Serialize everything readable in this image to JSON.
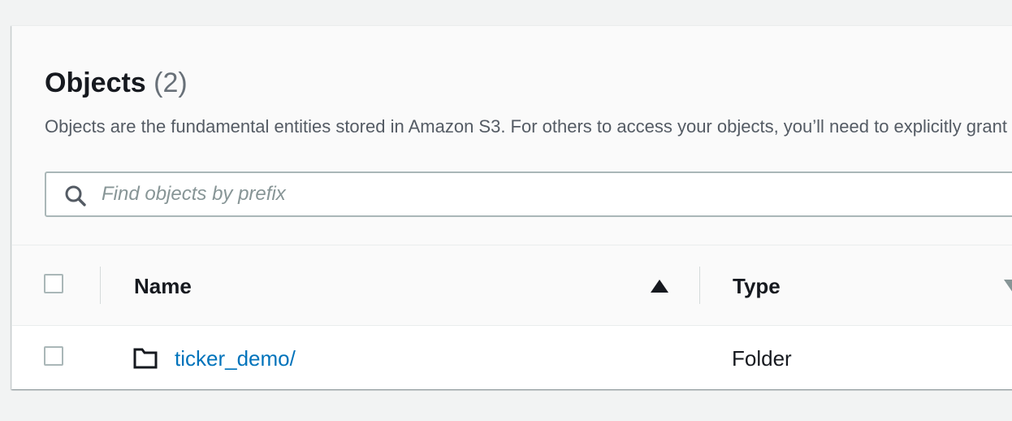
{
  "objects_panel": {
    "title": "Objects",
    "count": "(2)",
    "description": "Objects are the fundamental entities stored in Amazon S3. For others to access your objects, you’ll need to explicitly grant them permissions."
  },
  "search": {
    "placeholder": "Find objects by prefix",
    "value": "",
    "icon": "search-icon"
  },
  "table": {
    "columns": [
      {
        "label": "Name",
        "sort": "ascending",
        "sort_icon": "sort-ascending-icon"
      },
      {
        "label": "Type",
        "sort": "none",
        "sort_icon": "sort-descending-icon"
      }
    ],
    "rows": [
      {
        "name": "ticker_demo/",
        "type": "Folder",
        "icon": "folder-icon",
        "selected": false
      }
    ]
  },
  "colors": {
    "link": "#0073bb",
    "text": "#16191f",
    "muted": "#687078",
    "border": "#aab7b8",
    "page_bg": "#f2f3f3"
  }
}
